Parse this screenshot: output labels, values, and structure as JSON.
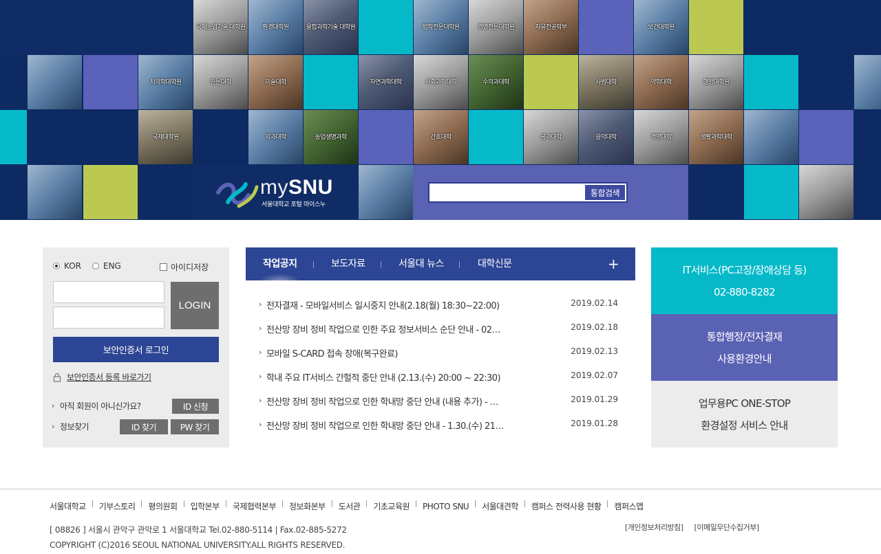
{
  "banner": {
    "tiles": [
      "국제농업기술 대학원",
      "환경대학원",
      "융합과학기술 대학원",
      "법학전문대학원",
      "경영전문대학원",
      "자유전공학부",
      "보건대학원",
      "치의학대학원",
      "인문대학",
      "미술대학",
      "자연과학대학",
      "사회과학대학",
      "수의과대학",
      "사범대학",
      "약학대학",
      "행정대학원",
      "국제대학원",
      "의과대학",
      "농업생명과학",
      "간호대학",
      "공과대학",
      "음악대학",
      "경영대학",
      "생활과학대학"
    ],
    "colors": {
      "navy": "#0f2c66",
      "cyan": "#06b9c9",
      "purple": "#5b62b9",
      "lime": "#bcc950"
    }
  },
  "logo": {
    "word_my": "my",
    "word_snu": "SNU",
    "subtitle": "서울대학교 포털 마이스누"
  },
  "search": {
    "placeholder": "",
    "button": "통합검색"
  },
  "login": {
    "lang_kor": "KOR",
    "lang_eng": "ENG",
    "save_id": "아이디저장",
    "login_button": "LOGIN",
    "cert_login": "보안인증서 로그인",
    "cert_register": "보안인증서 등록 바로가기",
    "not_member": "아직 회원이 아니신가요?",
    "id_apply": "ID 신청",
    "find_info": "정보찾기",
    "find_id": "ID 찾기",
    "find_pw": "PW 찾기"
  },
  "board": {
    "tabs": [
      "작업공지",
      "보도자료",
      "서울대 뉴스",
      "대학신문"
    ],
    "more": "+",
    "items": [
      {
        "title": "전자결재 - 모바일서비스 일시중지 안내(2.18(월) 18:30~22:00)",
        "date": "2019.02.14"
      },
      {
        "title": "전산망 장비 정비 작업으로 인한 주요 정보서비스 순단 안내 - 02…",
        "date": "2019.02.18"
      },
      {
        "title": "모바일 S-CARD 접속 장애(복구완료)",
        "date": "2019.02.13"
      },
      {
        "title": "학내 주요 IT서비스 간헐적 중단 안내 (2.13.(수) 20:00 ~ 22:30)",
        "date": "2019.02.07"
      },
      {
        "title": "전산망 장비 정비 작업으로 인한 학내망 중단 안내 (내용 추가) - …",
        "date": "2019.01.29"
      },
      {
        "title": "전산망 장비 정비 작업으로 인한 학내망 중단 안내 - 1.30.(수) 21…",
        "date": "2019.01.28"
      }
    ]
  },
  "right_banners": [
    {
      "line1": "IT서비스(PC고장/장애상담 등)",
      "line2": "02-880-8282"
    },
    {
      "line1": "통합행정/전자결재",
      "line2": "사용환경안내"
    },
    {
      "line1": "업무용PC ONE-STOP",
      "line2": "환경설정 서비스 안내"
    }
  ],
  "footer": {
    "links": [
      "서울대학교",
      "기부스토리",
      "평의원회",
      "입학본부",
      "국제협력본부",
      "정보화본부",
      "도서관",
      "기초교육원",
      "PHOTO SNU",
      "서울대견학",
      "캠퍼스 전력사용 현황",
      "캠퍼스맵"
    ],
    "address": "[ 08826 ] 서울시 관악구 관악로 1 서울대학교 Tel.02-880-5114   |   Fax.02-885-5272",
    "copyright": "COPYRIGHT (C)2016 SEOUL NATIONAL UNIVERSITY.ALL RIGHTS RESERVED.",
    "privacy": "[개인정보처리방침]",
    "email_policy": "[이메일무단수집거부]"
  }
}
